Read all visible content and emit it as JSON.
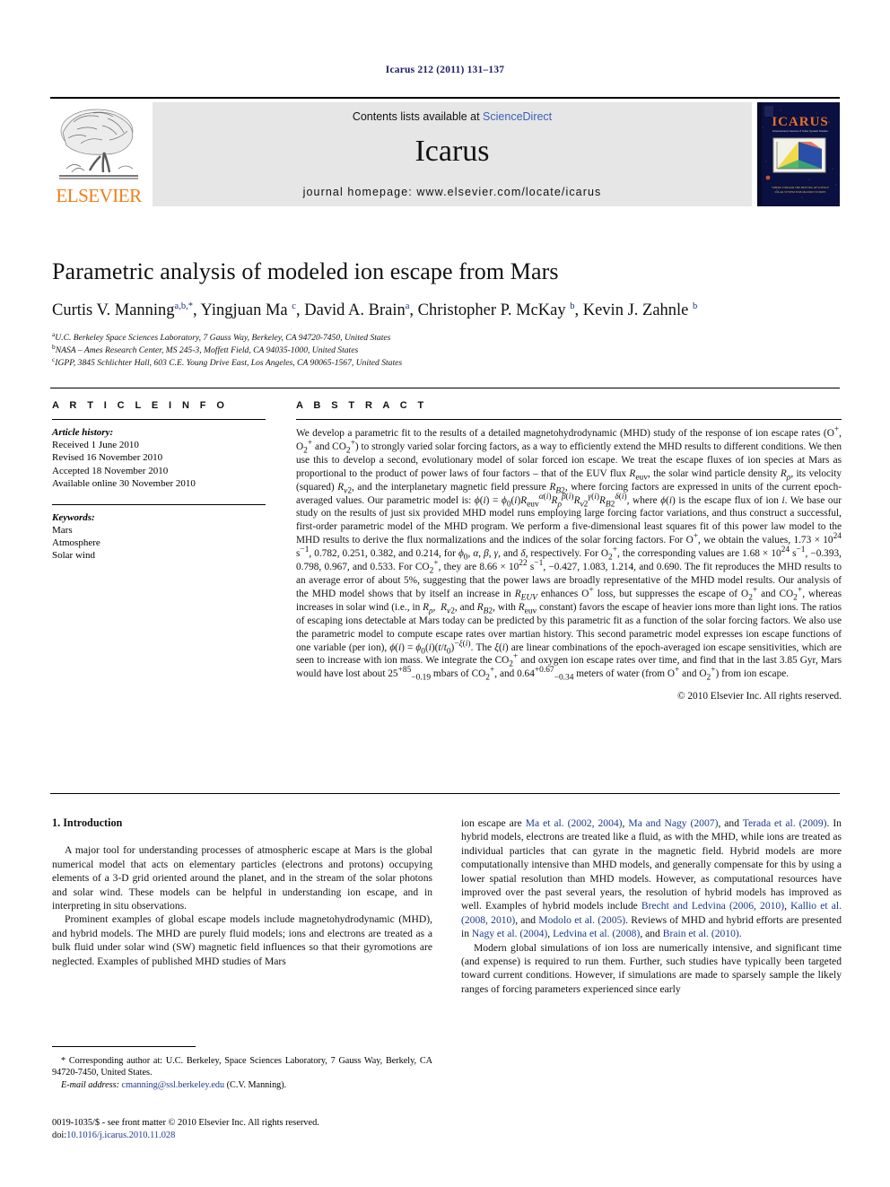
{
  "running_head": "Icarus 212 (2011) 131–137",
  "masthead": {
    "publisher_name": "ELSEVIER",
    "contents_prefix": "Contents lists available at ",
    "contents_link": "ScienceDirect",
    "journal_name": "Icarus",
    "homepage": "journal homepage: www.elsevier.com/locate/icarus",
    "cover_title": "ICARUS",
    "cover_subtitle": "International Journal of Solar System Studies",
    "cover_footer_line1": "WHERE STREAMS THE MEETING OF SCIENCE",
    "cover_footer_line2": "SOLAR SYSTEM EXPLORATION STUDIES"
  },
  "article": {
    "title": "Parametric analysis of modeled ion escape from Mars",
    "authors_html": "Curtis V. Manning<sup>a,b,*</sup>, Yingjuan Ma <sup>c</sup>, David A. Brain<sup>a</sup>, Christopher P. McKay <sup>b</sup>, Kevin J. Zahnle <sup>b</sup>",
    "affiliations": [
      {
        "marker": "a",
        "text": "U.C. Berkeley Space Sciences Laboratory, 7 Gauss Way, Berkeley, CA 94720-7450, United States"
      },
      {
        "marker": "b",
        "text": "NASA – Ames Research Center, MS 245-3, Moffett Field, CA 94035-1000, United States"
      },
      {
        "marker": "c",
        "text": "IGPP, 3845 Schlichter Hall, 603 C.E. Young Drive East, Los Angeles, CA 90065-1567, United States"
      }
    ]
  },
  "info": {
    "heading": "A R T I C L E    I N F O",
    "history_label": "Article history:",
    "history": [
      "Received 1 June 2010",
      "Revised 16 November 2010",
      "Accepted 18 November 2010",
      "Available online 30 November 2010"
    ],
    "keywords_label": "Keywords:",
    "keywords": [
      "Mars",
      "Atmosphere",
      "Solar wind"
    ]
  },
  "abstract": {
    "heading": "A B S T R A C T",
    "paragraph_html": "We develop a parametric fit to the results of a detailed magnetohydrodynamic (MHD) study of the response of ion escape rates (O<sup>+</sup>, O<sub>2</sub><sup>+</sup> and CO<sub>2</sub><sup>+</sup>) to strongly varied solar forcing factors, as a way to efficiently extend the MHD results to different conditions. We then use this to develop a second, evolutionary model of solar forced ion escape. We treat the escape fluxes of ion species at Mars as proportional to the product of power laws of four factors – that of the EUV flux <i>R</i><sub>euv</sub>, the solar wind particle density <i>R</i><sub><i>ρ</i></sub>, its velocity (squared) <i>R</i><sub><i>v</i>2</sub>, and the interplanetary magnetic field pressure <i>R</i><sub><i>B</i>2</sub>, where forcing factors are expressed in units of the current epoch-averaged values. Our parametric model is: <i>ϕ</i>(<i>i</i>) = <i>ϕ</i><sub>0</sub>(<i>i</i>)<i>R</i><sub>euv</sub><sup><i>α</i>(<i>i</i>)</sup><i>R</i><sub><i>ρ</i></sub><sup><i>β</i>(<i>i</i>)</sup><i>R</i><sub><i>v</i>2</sub><sup><i>γ</i>(<i>i</i>)</sup><i>R</i><sub><i>B</i>2</sub><sup><i>δ</i>(<i>i</i>)</sup>, where <i>ϕ</i>(<i>i</i>) is the escape flux of ion <i>i</i>. We base our study on the results of just six provided MHD model runs employing large forcing factor variations, and thus construct a successful, first-order parametric model of the MHD program. We perform a five-dimensional least squares fit of this power law model to the MHD results to derive the flux normalizations and the indices of the solar forcing factors. For O<sup>+</sup>, we obtain the values, 1.73 × 10<sup>24</sup> s<sup>−1</sup>, 0.782, 0.251, 0.382, and 0.214, for <i>ϕ</i><sub>0</sub>, <i>α</i>, <i>β</i>, <i>γ</i>, and <i>δ</i>, respectively. For O<sub>2</sub><sup>+</sup>, the corresponding values are 1.68 × 10<sup>24</sup> s<sup>−1</sup>, −0.393, 0.798, 0.967, and 0.533. For CO<sub>2</sub><sup>+</sup>, they are 8.66 × 10<sup>22</sup> s<sup>−1</sup>, −0.427, 1.083, 1.214, and 0.690. The fit reproduces the MHD results to an average error of about 5%, suggesting that the power laws are broadly representative of the MHD model results. Our analysis of the MHD model shows that by itself an increase in <i>R</i><sub><i>EUV</i></sub> enhances O<sup>+</sup> loss, but suppresses the escape of O<sub>2</sub><sup>+</sup> and CO<sub>2</sub><sup>+</sup>, whereas increases in solar wind (i.e., in <i>R</i><sub><i>ρ</i></sub>,&nbsp; <i>R</i><sub><i>v</i>2</sub>, and <i>R</i><sub><i>B</i>2</sub>, with <i>R</i><sub>euv</sub> constant) favors the escape of heavier ions more than light ions. The ratios of escaping ions detectable at Mars today can be predicted by this parametric fit as a function of the solar forcing factors. We also use the parametric model to compute escape rates over martian history. This second parametric model expresses ion escape functions of one variable (per ion), <i>ϕ</i>(<i>i</i>) = <i>ϕ</i><sub>0</sub>(<i>i</i>)(<i>t</i>/<i>t</i><sub>0</sub>)<sup>−<i>ξ</i>(<i>i</i>)</sup>. The <i>ξ</i>(<i>i</i>) are linear combinations of the epoch-averaged ion escape sensitivities, which are seen to increase with ion mass. We integrate the CO<sub>2</sub><sup>+</sup> and oxygen ion escape rates over time, and find that in the last 3.85 Gyr, Mars would have lost about 25<sup>+85</sup><sub>−0.19</sub> mbars of CO<sub>2</sub><sup>+</sup>, and 0.64<sup>+0.67</sup><sub>−0.34</sub> meters of water (from O<sup>+</sup> and O<sub>2</sub><sup>+</sup>) from ion escape.",
    "copyright": "© 2010 Elsevier Inc. All rights reserved."
  },
  "body": {
    "section_number_title": "1. Introduction",
    "left_paragraphs_html": [
      "A major tool for understanding processes of atmospheric escape at Mars is the global numerical model that acts on elementary particles (electrons and protons) occupying elements of a 3-D grid oriented around the planet, and in the stream of the solar photons and solar wind. These models can be helpful in understanding ion escape, and in interpreting in situ observations.",
      "Prominent examples of global escape models include magnetohydrodynamic (MHD), and hybrid models. The MHD are purely fluid models; ions and electrons are treated as a bulk fluid under solar wind (SW) magnetic field influences so that their gyromotions are neglected. Examples of published MHD studies of Mars"
    ],
    "right_paragraphs_html": [
      "ion escape are <span class=\"ref\">Ma et al. (2002, 2004)</span>, <span class=\"ref\">Ma and Nagy (2007)</span>, and <span class=\"ref\">Terada et al. (2009)</span>. In hybrid models, electrons are treated like a fluid, as with the MHD, while ions are treated as individual particles that can gyrate in the magnetic field. Hybrid models are more computationally intensive than MHD models, and generally compensate for this by using a lower spatial resolution than MHD models. However, as computational resources have improved over the past several years, the resolution of hybrid models has improved as well. Examples of hybrid models include <span class=\"ref\">Brecht and Ledvina (2006, 2010)</span>, <span class=\"ref\">Kallio et al. (2008, 2010)</span>, and <span class=\"ref\">Modolo et al. (2005)</span>. Reviews of MHD and hybrid efforts are presented in <span class=\"ref\">Nagy et al. (2004)</span>, <span class=\"ref\">Ledvina et al. (2008)</span>, and <span class=\"ref\">Brain et al. (2010)</span>.",
      "Modern global simulations of ion loss are numerically intensive, and significant time (and expense) is required to run them. Further, such studies have typically been targeted toward current conditions. However, if simulations are made to sparsely sample the likely ranges of forcing parameters experienced since early"
    ]
  },
  "footnotes": {
    "corresponding_html": "* Corresponding author at: U.C. Berkeley, Space Sciences Laboratory, 7 Gauss Way, Berkely, CA 94720-7450, United States.",
    "email_label": "E-mail address:",
    "email": "cmanning@ssl.berkeley.edu",
    "email_suffix": "(C.V. Manning)."
  },
  "imprint": {
    "issn_line": "0019-1035/$ - see front matter © 2010 Elsevier Inc. All rights reserved.",
    "doi_label": "doi:",
    "doi": "10.1016/j.icarus.2010.11.028"
  },
  "colors": {
    "link": "#1b3a8c",
    "sciencedirect": "#3a5fbd",
    "elsevier_orange": "#ef7d1a",
    "panel_gray": "#e6e6e6",
    "cover_bg": "#0a0a3c",
    "runhead": "#1b1b66"
  }
}
